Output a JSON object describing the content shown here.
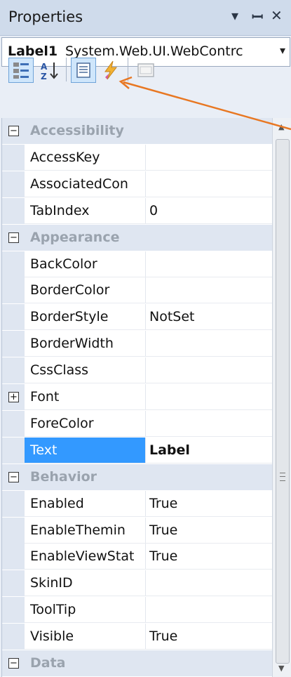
{
  "title": "Properties",
  "title_buttons": {
    "dropdown": "▾",
    "pin": "ᵽ",
    "close": "✕"
  },
  "object_selector": {
    "name": "Label1",
    "type": "System.Web.UI.WebContrc",
    "dropdown": "▾"
  },
  "toolbar": {
    "buttons": [
      {
        "id": "categorized",
        "icon": "categorized-icon",
        "active": true
      },
      {
        "id": "alphabetical",
        "icon": "sort-az-icon",
        "active": false
      },
      {
        "id": "properties",
        "icon": "properties-page-icon",
        "active": true
      },
      {
        "id": "events",
        "icon": "lightning-icon",
        "active": false
      },
      {
        "id": "property-pages",
        "icon": "property-pages-icon",
        "active": false
      }
    ],
    "annotation_color": "#e87722"
  },
  "rows": [
    {
      "kind": "category",
      "expander": "⊟",
      "name": "Accessibility",
      "value": ""
    },
    {
      "kind": "prop",
      "name": "AccessKey",
      "value": ""
    },
    {
      "kind": "prop",
      "name": "AssociatedCon",
      "value": ""
    },
    {
      "kind": "prop",
      "name": "TabIndex",
      "value": "0"
    },
    {
      "kind": "category",
      "expander": "⊟",
      "name": "Appearance",
      "value": ""
    },
    {
      "kind": "prop",
      "name": "BackColor",
      "value": ""
    },
    {
      "kind": "prop",
      "name": "BorderColor",
      "value": ""
    },
    {
      "kind": "prop",
      "name": "BorderStyle",
      "value": "NotSet"
    },
    {
      "kind": "prop",
      "name": "BorderWidth",
      "value": ""
    },
    {
      "kind": "prop",
      "name": "CssClass",
      "value": ""
    },
    {
      "kind": "prop-expand",
      "expander": "⊞",
      "name": "Font",
      "value": ""
    },
    {
      "kind": "prop",
      "name": "ForeColor",
      "value": ""
    },
    {
      "kind": "selected",
      "name": "Text",
      "value": "Label"
    },
    {
      "kind": "category",
      "expander": "⊟",
      "name": "Behavior",
      "value": ""
    },
    {
      "kind": "prop",
      "name": "Enabled",
      "value": "True"
    },
    {
      "kind": "prop",
      "name": "EnableThemin",
      "value": "True"
    },
    {
      "kind": "prop",
      "name": "EnableViewStat",
      "value": "True"
    },
    {
      "kind": "prop",
      "name": "SkinID",
      "value": ""
    },
    {
      "kind": "prop",
      "name": "ToolTip",
      "value": ""
    },
    {
      "kind": "prop",
      "name": "Visible",
      "value": "True"
    },
    {
      "kind": "category",
      "expander": "⊟",
      "name": "Data",
      "value": ""
    }
  ],
  "scrollbar": {
    "up": "▲",
    "down": "▼"
  }
}
